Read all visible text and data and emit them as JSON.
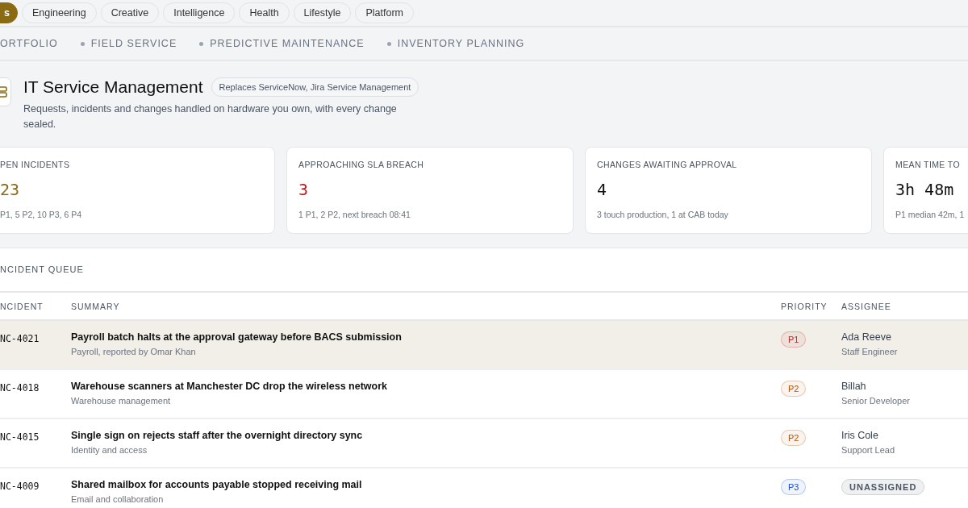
{
  "categories": [
    {
      "label": "s",
      "selected": true
    },
    {
      "label": "Engineering",
      "selected": false
    },
    {
      "label": "Creative",
      "selected": false
    },
    {
      "label": "Intelligence",
      "selected": false
    },
    {
      "label": "Health",
      "selected": false
    },
    {
      "label": "Lifestyle",
      "selected": false
    },
    {
      "label": "Platform",
      "selected": false
    }
  ],
  "subnav": [
    "ORTFOLIO",
    "FIELD SERVICE",
    "PREDICTIVE MAINTENANCE",
    "INVENTORY PLANNING"
  ],
  "header": {
    "title": "IT Service Management",
    "badge": "Replaces ServiceNow, Jira Service Management",
    "description": "Requests, incidents and changes handled on hardware you own, with every change sealed."
  },
  "stats": [
    {
      "label": "PEN INCIDENTS",
      "value": "23",
      "color": "#8a6a12",
      "note": "P1, 5 P2, 10 P3, 6 P4"
    },
    {
      "label": "APPROACHING SLA BREACH",
      "value": "3",
      "color": "#c0161c",
      "note": "1 P1, 2 P2, next breach 08:41"
    },
    {
      "label": "CHANGES AWAITING APPROVAL",
      "value": "4",
      "color": "#111111",
      "note": "3 touch production, 1 at CAB today"
    },
    {
      "label": "MEAN TIME TO",
      "value": "3h 48m",
      "color": "#111111",
      "note": "P1 median 42m, 1"
    }
  ],
  "queue": {
    "title": "NCIDENT QUEUE",
    "columns": [
      "NCIDENT",
      "SUMMARY",
      "PRIORITY",
      "ASSIGNEE"
    ],
    "rows": [
      {
        "id": "NC-4021",
        "summary": "Payroll batch halts at the approval gateway before BACS submission",
        "detail": "Payroll, reported by Omar Khan",
        "priority": "P1",
        "color": "#c0262d",
        "assignee": {
          "kind": "person",
          "name": "Ada Reeve",
          "role": "Staff Engineer"
        },
        "selected": true
      },
      {
        "id": "NC-4018",
        "summary": "Warehouse scanners at Manchester DC drop the wireless network",
        "detail": "Warehouse management",
        "priority": "P2",
        "color": "#b4530e",
        "assignee": {
          "kind": "person",
          "name": "Billah",
          "role": "Senior Developer"
        },
        "selected": false
      },
      {
        "id": "NC-4015",
        "summary": "Single sign on rejects staff after the overnight directory sync",
        "detail": "Identity and access",
        "priority": "P2",
        "color": "#b4530e",
        "assignee": {
          "kind": "person",
          "name": "Iris Cole",
          "role": "Support Lead"
        },
        "selected": false
      },
      {
        "id": "NC-4009",
        "summary": "Shared mailbox for accounts payable stopped receiving mail",
        "detail": "Email and collaboration",
        "priority": "P3",
        "color": "#1d4ed8",
        "assignee": {
          "kind": "unassigned",
          "name": "UNASSIGNED"
        },
        "selected": false
      }
    ]
  }
}
